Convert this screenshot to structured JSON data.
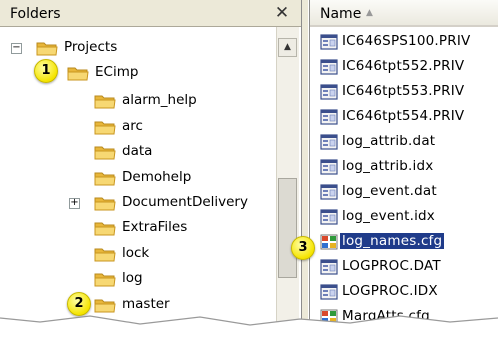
{
  "folders_pane": {
    "title": "Folders",
    "close_glyph": "✕",
    "tree": [
      {
        "label": "Projects",
        "expander": "−"
      },
      {
        "label": "ECimp",
        "expander": ""
      },
      {
        "label": "alarm_help",
        "expander": ""
      },
      {
        "label": "arc",
        "expander": ""
      },
      {
        "label": "data",
        "expander": ""
      },
      {
        "label": "Demohelp",
        "expander": ""
      },
      {
        "label": "DocumentDelivery",
        "expander": "+"
      },
      {
        "label": "ExtraFiles",
        "expander": ""
      },
      {
        "label": "lock",
        "expander": ""
      },
      {
        "label": "log",
        "expander": ""
      },
      {
        "label": "master",
        "expander": ""
      }
    ]
  },
  "files_pane": {
    "column_header": "Name",
    "sort_glyph": "▲",
    "files": [
      {
        "label": "IC646SPS100.PRIV",
        "icon": "config-file-icon"
      },
      {
        "label": "IC646tpt552.PRIV",
        "icon": "config-file-icon"
      },
      {
        "label": "IC646tpt553.PRIV",
        "icon": "config-file-icon"
      },
      {
        "label": "IC646tpt554.PRIV",
        "icon": "config-file-icon"
      },
      {
        "label": "log_attrib.dat",
        "icon": "config-file-icon"
      },
      {
        "label": "log_attrib.idx",
        "icon": "config-file-icon"
      },
      {
        "label": "log_event.dat",
        "icon": "config-file-icon"
      },
      {
        "label": "log_event.idx",
        "icon": "config-file-icon"
      },
      {
        "label": "log_names.cfg",
        "icon": "cfg-file-icon",
        "selected": true
      },
      {
        "label": "LOGPROC.DAT",
        "icon": "config-file-icon"
      },
      {
        "label": "LOGPROC.IDX",
        "icon": "config-file-icon"
      },
      {
        "label": "MargAtts.cfg",
        "icon": "cfg-file-icon"
      }
    ]
  },
  "callouts": [
    "1",
    "2",
    "3"
  ],
  "colors": {
    "folder_yellow": "#f3c84a",
    "selection_blue": "#1f3b8a",
    "callout_yellow": "#f5e400",
    "pane_header": "#ece9d8"
  }
}
